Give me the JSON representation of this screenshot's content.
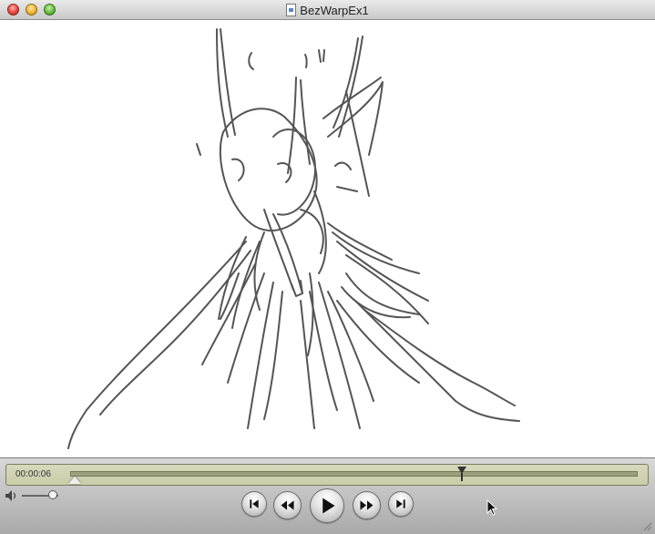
{
  "window": {
    "title": "BezWarpEx1",
    "icons": [
      "close-icon",
      "minimize-icon",
      "zoom-icon",
      "document-icon"
    ]
  },
  "player": {
    "timecode": "00:00:06",
    "progress_fraction": 0.69,
    "volume_fraction": 0.85,
    "lcd_color": "#c9cda8",
    "icons": [
      "volume-icon",
      "skip-to-start-icon",
      "rewind-icon",
      "play-icon",
      "fast-forward-icon",
      "skip-to-end-icon",
      "resize-grip-icon",
      "pointer-cursor-icon"
    ]
  },
  "colors": {
    "sketch_stroke": "#555555",
    "canvas_bg": "#ffffff"
  }
}
